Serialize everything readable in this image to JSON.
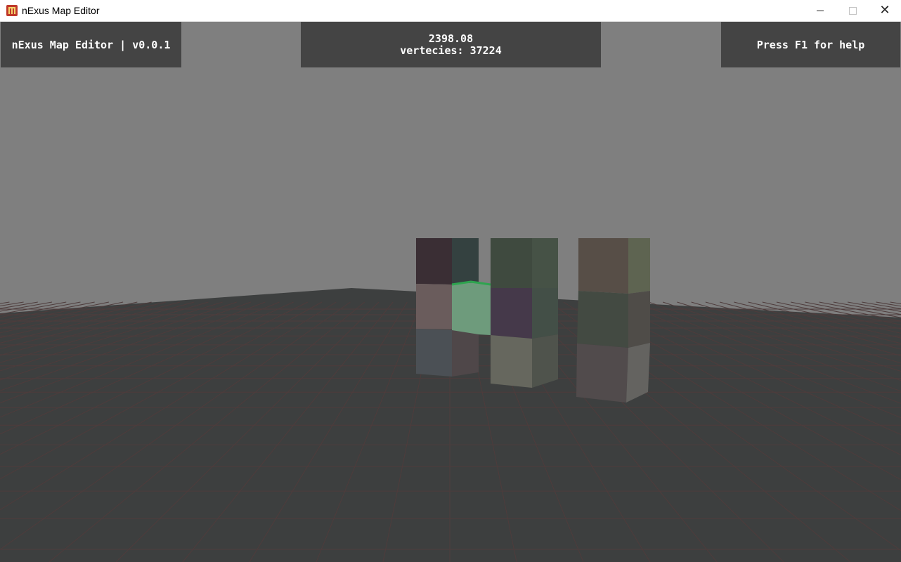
{
  "window": {
    "title": "nExus Map Editor",
    "icon": "app-logo-icon",
    "controls": [
      "minimize-icon",
      "maximize-icon",
      "close-icon"
    ]
  },
  "hud": {
    "version_label": "nExus Map Editor | v0.0.1",
    "fps": "2398.08",
    "vertices": "vertecies: 37224",
    "help_hint": "Press F1 for help"
  },
  "scene": {
    "sky_color": "#7f7f7f",
    "ground_color": "#3d3f3f",
    "grid_line_color": "#4e3c3c",
    "selected_block_color": "#6e9b7c",
    "selected_block_outline": "#2ea44f"
  }
}
